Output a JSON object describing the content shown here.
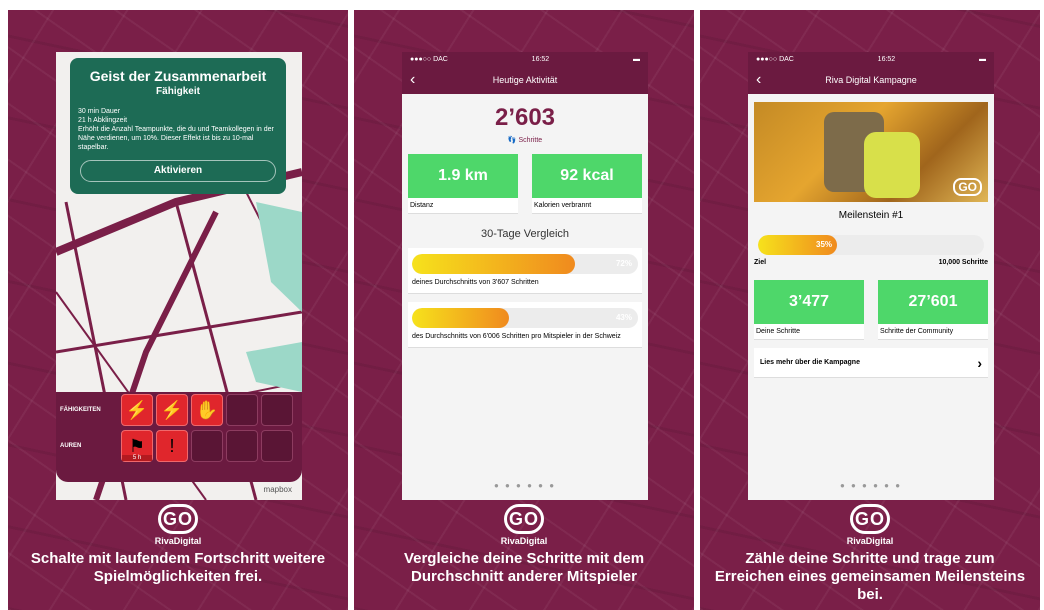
{
  "panels": [
    {
      "tooltip": {
        "title": "Geist der Zusammenarbeit",
        "subtitle": "Fähigkeit",
        "body": "30 min Dauer\n21 h Abklingzeit\nErhöht die Anzahl Teampunkte, die du und Teamkollegen in der Nähe verdienen, um 10%. Dieser Effekt ist bis zu 10-mal stapelbar.",
        "button": "Aktivieren"
      },
      "skills_label": "FÄHIGKEITEN",
      "auras_label": "AUREN",
      "aura_timer": "5 h",
      "map_attr": "mapbox",
      "caption": "Schalte mit laufendem Fortschritt weitere Spielmöglichkeiten frei."
    },
    {
      "status": {
        "carrier": "●●●○○ DAC",
        "time": "16:52"
      },
      "title": "Heutige Aktivität",
      "steps": "2’603",
      "steps_label": "Schritte",
      "distance": "1.9 km",
      "distance_label": "Distanz",
      "calories": "92 kcal",
      "calories_label": "Kalorien verbrannt",
      "section": "30-Tage Vergleich",
      "bar1_pct": "72%",
      "bar1_text": "deines Durchschnitts von 3'607 Schritten",
      "bar2_pct": "43%",
      "bar2_text": "des Durchschnitts von 6'006 Schritten pro Mitspieler in der Schweiz",
      "dots": "● ● ● ● ● ●",
      "caption": "Vergleiche deine Schritte mit dem Durchschnitt anderer Mitspieler"
    },
    {
      "status": {
        "carrier": "●●●○○ DAC",
        "time": "16:52"
      },
      "title": "Riva Digital Kampagne",
      "milestone": "Meilenstein #1",
      "pct": "35%",
      "goal_label": "Ziel",
      "goal_value": "10,000 Schritte",
      "own": "3’477",
      "own_label": "Deine Schritte",
      "community": "27’601",
      "community_label": "Schritte der Community",
      "more": "Lies mehr über die Kampagne",
      "dots": "● ● ● ● ● ●",
      "caption": "Zähle deine Schritte und trage zum Erreichen eines gemeinsamen Meilensteins bei."
    }
  ],
  "brand": "RivaDigital",
  "logo": "GO",
  "progress": {
    "bar1": 0.72,
    "bar2": 0.43,
    "milestone": 0.35
  }
}
